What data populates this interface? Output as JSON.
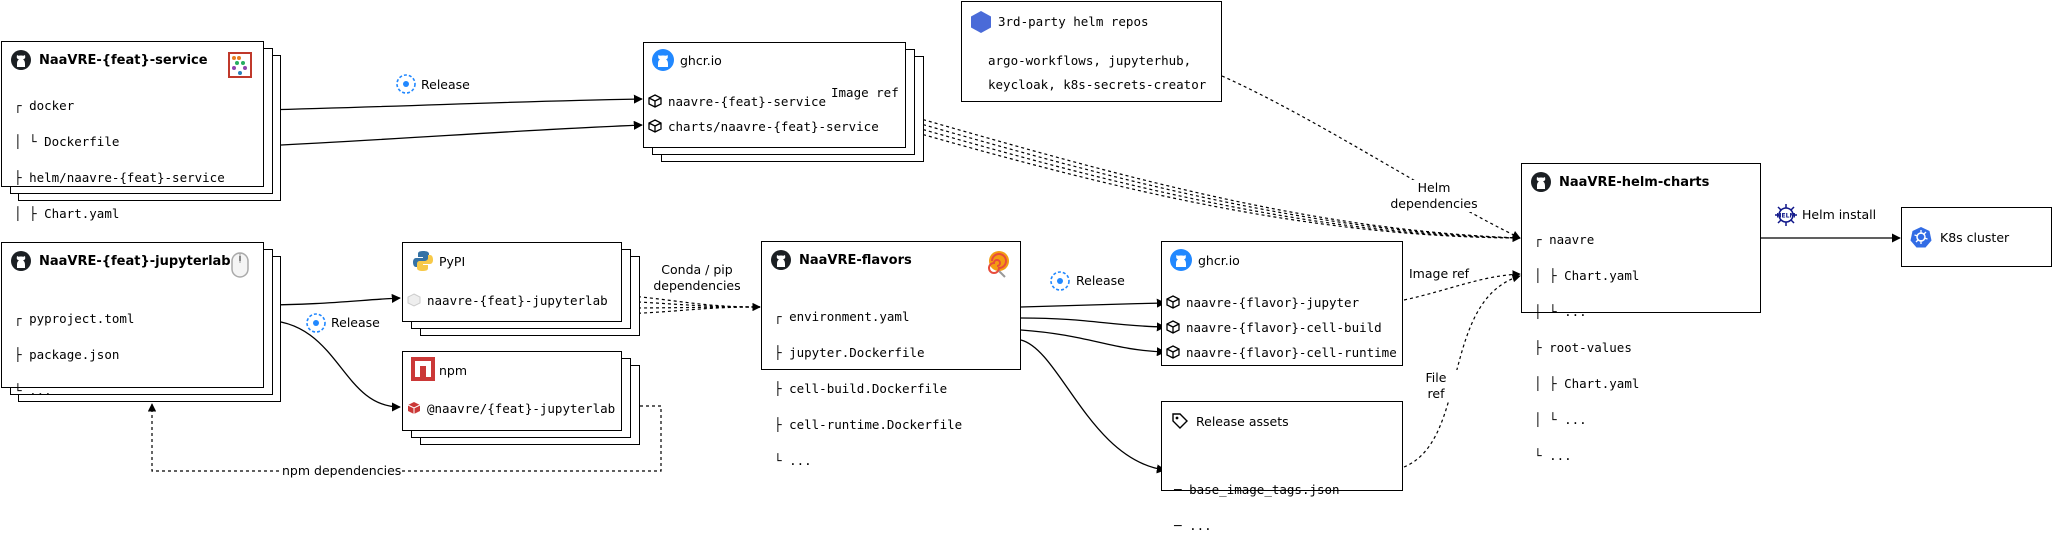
{
  "colors": {
    "line": "#000000",
    "github": "#1b1f23",
    "ghcr": "#2188ff",
    "npm": "#cb3837",
    "helm": "#0f1689",
    "k8s": "#326ce5",
    "argo": "#4a6bd8"
  },
  "service_repo": {
    "title": "NaaVRE-{feat}-service",
    "icon": "abacus-icon",
    "tree": [
      "docker",
      "Dockerfile",
      "helm/naavre-{feat}-service",
      "Chart.yaml",
      "...",
      "..."
    ]
  },
  "jupyterlab_repo": {
    "title": "NaaVRE-{feat}-jupyterlab",
    "icon": "mouse-icon",
    "tree": [
      "pyproject.toml",
      "package.json",
      "..."
    ]
  },
  "ghcr_top": {
    "title": "ghcr.io",
    "items": [
      "naavre-{feat}-service",
      "charts/naavre-{feat}-service"
    ]
  },
  "pypi": {
    "title": "PyPI",
    "item": "naavre-{feat}-jupyterlab"
  },
  "npm": {
    "title": "npm",
    "item": "@naavre/{feat}-jupyterlab"
  },
  "flavors_repo": {
    "title": "NaaVRE-flavors",
    "icon": "lollipop-icon",
    "tree": [
      "environment.yaml",
      "jupyter.Dockerfile",
      "cell-build.Dockerfile",
      "cell-runtime.Dockerfile",
      "..."
    ]
  },
  "ghcr_flavors": {
    "title": "ghcr.io",
    "items": [
      "naavre-{flavor}-jupyter",
      "naavre-{flavor}-cell-build",
      "naavre-{flavor}-cell-runtime"
    ]
  },
  "release_assets": {
    "title": "Release assets",
    "items": [
      "base_image_tags.json",
      "..."
    ]
  },
  "third_party": {
    "title": "3rd-party helm repos",
    "line1": "argo-workflows, jupyterhub,",
    "line2": "keycloak, k8s-secrets-creator"
  },
  "helm_charts_repo": {
    "title": "NaaVRE-helm-charts",
    "tree": [
      "naavre",
      "Chart.yaml",
      "...",
      "root-values",
      "Chart.yaml",
      "...",
      "..."
    ]
  },
  "k8s": {
    "title": "K8s cluster"
  },
  "edges": {
    "release_service": "Release",
    "image_ref_top": "Image ref",
    "release_jupyterlab": "Release",
    "conda_pip": "Conda / pip\ndependencies",
    "release_flavors": "Release",
    "image_ref_flavors": "Image ref",
    "file_ref": "File\nref",
    "helm_deps": "Helm\ndependencies",
    "helm_install": "Helm install",
    "npm_deps": "npm dependencies"
  }
}
